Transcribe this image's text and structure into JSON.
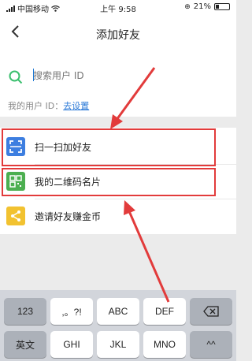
{
  "status_bar": {
    "carrier": "中国移动",
    "time": "上午 9:58",
    "battery": "21%"
  },
  "nav": {
    "title": "添加好友"
  },
  "search": {
    "placeholder": "搜索用户 ID",
    "my_id_label": "我的用户 ID：",
    "my_id_link": "去设置"
  },
  "menu": [
    {
      "label": "扫一扫加好友",
      "icon": "scan-icon",
      "color": "#3d7ee0"
    },
    {
      "label": "我的二维码名片",
      "icon": "qrcode-icon",
      "color": "#4caf50"
    },
    {
      "label": "邀请好友赚金币",
      "icon": "share-icon",
      "color": "#f2c230"
    }
  ],
  "keyboard": {
    "row1": [
      "123",
      ",。?!",
      "ABC",
      "DEF"
    ],
    "row2": [
      "英文",
      "GHI",
      "JKL",
      "MNO",
      "^^"
    ]
  },
  "colors": {
    "accent": "#3d7ee0",
    "annotation": "#e23b3b"
  }
}
